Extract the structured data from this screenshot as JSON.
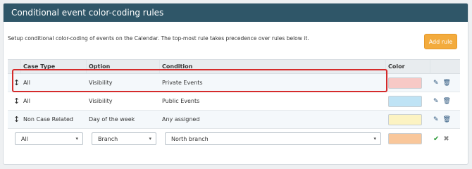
{
  "panel": {
    "title": "Conditional event color-coding rules",
    "description": "Setup conditional color-coding of events on the Calendar. The top-most rule takes precedence over rules below it.",
    "add_rule_label": "Add rule"
  },
  "table": {
    "headers": {
      "case_type": "Case Type",
      "option": "Option",
      "condition": "Condition",
      "color": "Color"
    },
    "rows": [
      {
        "case_type": "All",
        "option": "Visibility",
        "condition": "Private Events",
        "color": "#f7c9c6"
      },
      {
        "case_type": "All",
        "option": "Visibility",
        "condition": "Public Events",
        "color": "#bfe3f5"
      },
      {
        "case_type": "Non Case Related",
        "option": "Day of the week",
        "condition": "Any assigned",
        "color": "#fcf3c2"
      }
    ],
    "edit_row": {
      "case_type": "All",
      "option": "Branch",
      "condition": "North branch",
      "color": "#f9c79b"
    }
  },
  "icons": {
    "drag": "drag-handle-icon",
    "edit": "pencil-icon",
    "delete": "trash-icon",
    "confirm": "check-icon",
    "cancel": "close-icon"
  },
  "colors": {
    "header_bg": "#2f5668",
    "accent": "#f3ab3d",
    "highlight": "#d52b2b"
  }
}
